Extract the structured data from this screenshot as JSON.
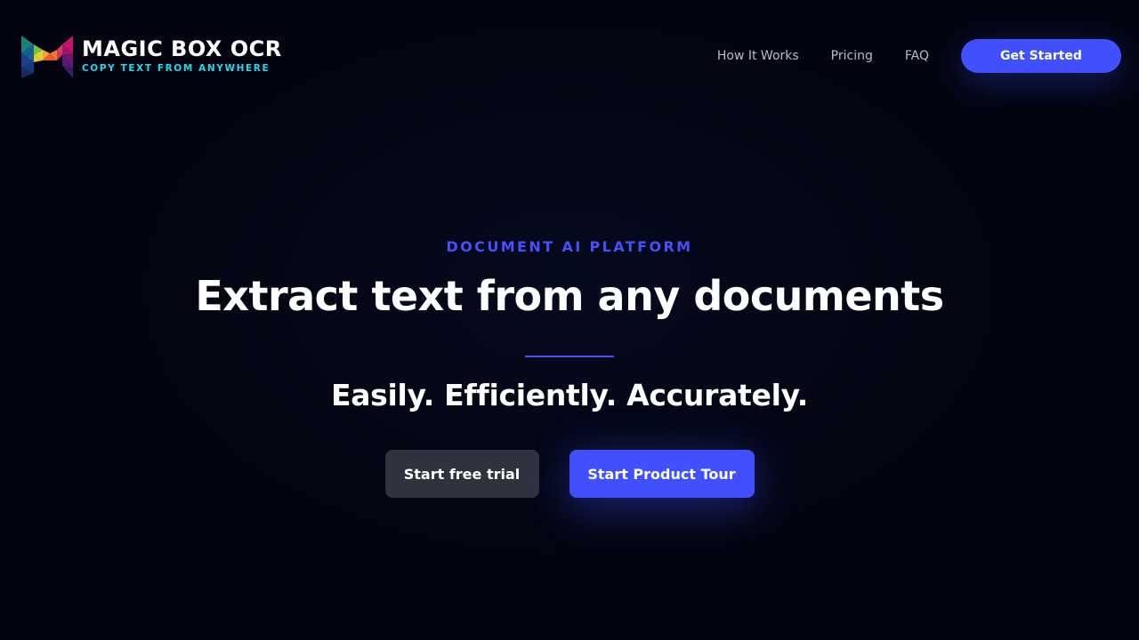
{
  "brand": {
    "name": "MAGIC BOX OCR",
    "tagline": "COPY TEXT FROM ANYWHERE",
    "logo_icon": "magic-box-m-logo-icon",
    "colors": {
      "tagline": "#22d8ea",
      "accent": "#4050ff",
      "background": "#020413"
    }
  },
  "nav": {
    "links": [
      {
        "label": "How It Works"
      },
      {
        "label": "Pricing"
      },
      {
        "label": "FAQ"
      }
    ],
    "cta_label": "Get Started"
  },
  "hero": {
    "eyebrow": "DOCUMENT AI PLATFORM",
    "headline": "Extract text from any documents",
    "subheadline": "Easily. Efficiently. Accurately.",
    "secondary_button": "Start free trial",
    "primary_button": "Start Product Tour"
  }
}
